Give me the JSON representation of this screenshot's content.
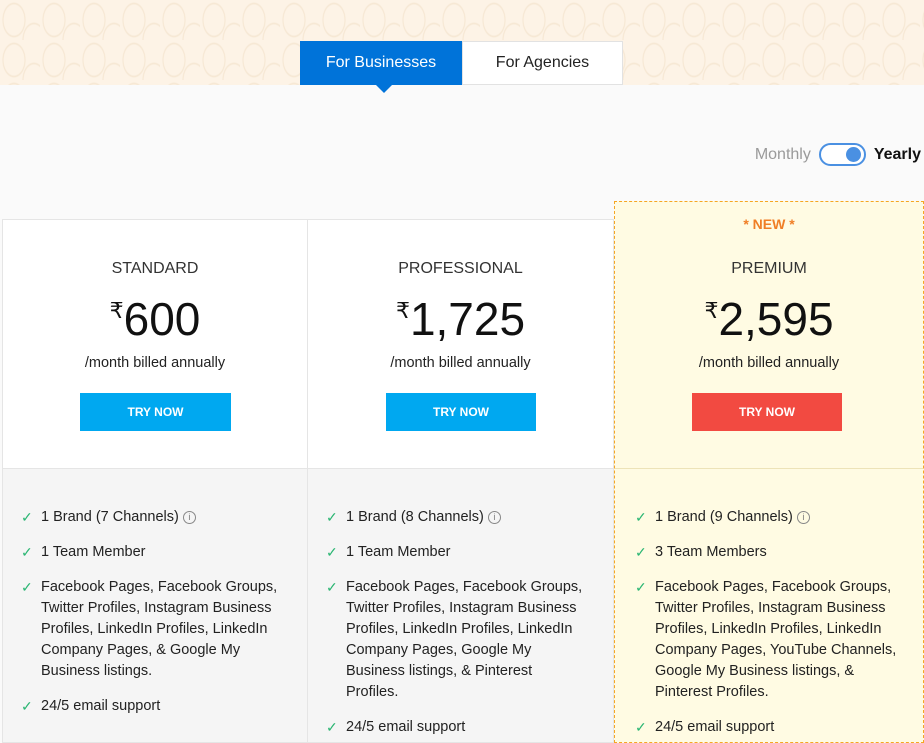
{
  "tabs": [
    {
      "label": "For Businesses",
      "active": true
    },
    {
      "label": "For Agencies",
      "active": false
    }
  ],
  "billing_toggle": {
    "left_label": "Monthly",
    "right_label": "Yearly",
    "selected": "Yearly"
  },
  "colors": {
    "primary_blue": "#0073d9",
    "try_blue": "#00a8f0",
    "try_red": "#f24a41",
    "check_green": "#2bb673",
    "new_orange": "#f07e26",
    "premium_bg": "#fffbe3"
  },
  "icons": {
    "check": "check-icon",
    "info": "info-icon",
    "currency": "rupee-sign"
  },
  "plans": [
    {
      "badge": "",
      "name": "STANDARD",
      "currency": "₹",
      "price": "600",
      "billing": "/month billed annually",
      "cta": "TRY NOW",
      "features": [
        {
          "text": "1 Brand (7 Channels)",
          "info": true
        },
        {
          "text": "1 Team Member",
          "info": false
        },
        {
          "text": "Facebook Pages, Facebook Groups, Twitter Profiles, Instagram Business Profiles, LinkedIn Profiles, LinkedIn Company Pages, & Google My Business listings.",
          "info": false
        },
        {
          "text": "24/5 email support",
          "info": false
        }
      ]
    },
    {
      "badge": "",
      "name": "PROFESSIONAL",
      "currency": "₹",
      "price": "1,725",
      "billing": "/month billed annually",
      "cta": "TRY NOW",
      "features": [
        {
          "text": "1 Brand (8 Channels)",
          "info": true
        },
        {
          "text": "1 Team Member",
          "info": false
        },
        {
          "text": "Facebook Pages, Facebook Groups, Twitter Profiles, Instagram Business Profiles, LinkedIn Profiles, LinkedIn Company Pages, Google My Business listings, & Pinterest Profiles.",
          "info": false
        },
        {
          "text": "24/5 email support",
          "info": false
        }
      ]
    },
    {
      "badge": "* NEW *",
      "name": "PREMIUM",
      "currency": "₹",
      "price": "2,595",
      "billing": "/month billed annually",
      "cta": "TRY NOW",
      "features": [
        {
          "text": "1 Brand (9 Channels)",
          "info": true
        },
        {
          "text": "3 Team Members",
          "info": false
        },
        {
          "text": "Facebook Pages, Facebook Groups, Twitter Profiles, Instagram Business Profiles, LinkedIn Profiles, LinkedIn Company Pages, YouTube Channels, Google My Business listings, & Pinterest Profiles.",
          "info": false
        },
        {
          "text": "24/5 email support",
          "info": false
        }
      ]
    }
  ]
}
